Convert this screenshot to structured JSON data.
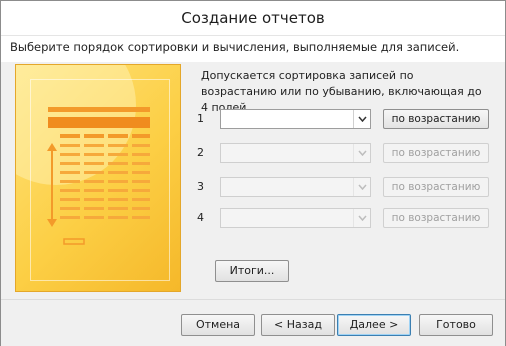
{
  "window": {
    "title": "Создание отчетов"
  },
  "instruction": "Выберите порядок сортировки и вычисления, выполняемые для записей.",
  "description": "Допускается сортировка записей по возрастанию или по убыванию, включающая до 4 полей.",
  "sort_rows": [
    {
      "number": "1",
      "field_value": "",
      "order_label": "по возрастанию",
      "enabled": true
    },
    {
      "number": "2",
      "field_value": "",
      "order_label": "по возрастанию",
      "enabled": false
    },
    {
      "number": "3",
      "field_value": "",
      "order_label": "по возрастанию",
      "enabled": false
    },
    {
      "number": "4",
      "field_value": "",
      "order_label": "по возрастанию",
      "enabled": false
    }
  ],
  "summary_button": "Итоги...",
  "footer": {
    "cancel": "Отмена",
    "back": "< Назад",
    "next": "Далее >",
    "finish": "Готово"
  },
  "colors": {
    "picture_bg": "#fccf45",
    "picture_accent": "#f39a2a",
    "default_button_border": "#3c7fb1"
  }
}
